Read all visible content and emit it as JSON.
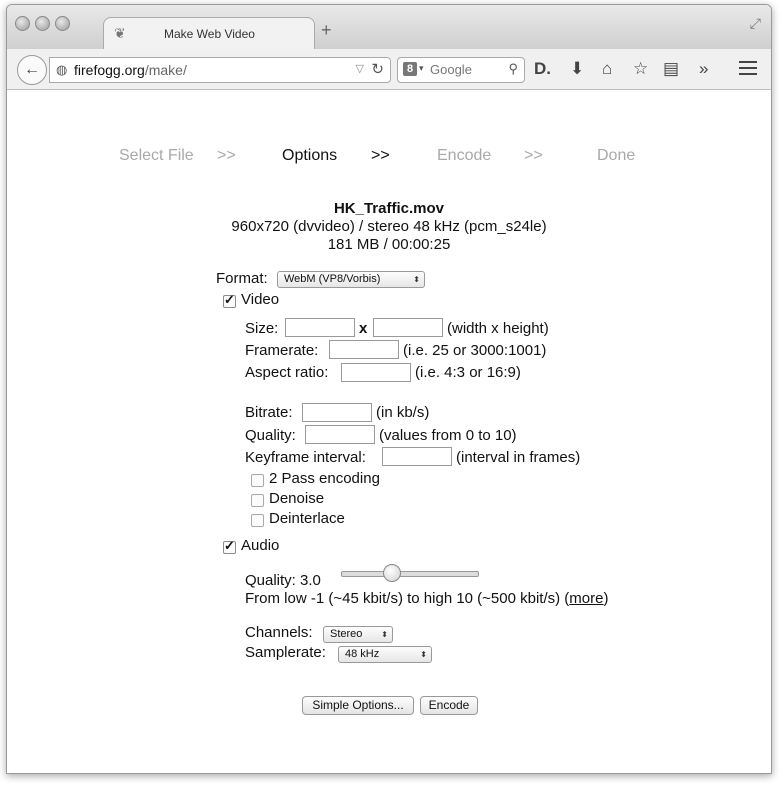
{
  "window": {
    "tab_title": "Make Web Video",
    "url_host": "firefogg.org",
    "url_path": "/make/",
    "search_placeholder": "Google"
  },
  "steps": [
    "Select File",
    ">>",
    "Options",
    ">>",
    "Encode",
    ">>",
    "Done"
  ],
  "file": {
    "name": "HK_Traffic.mov",
    "line1": "960x720 (dvvideo) / stereo 48 kHz (pcm_s24le)",
    "line2": "181 MB / 00:00:25"
  },
  "format": {
    "label": "Format:",
    "value": "WebM (VP8/Vorbis)"
  },
  "video": {
    "label": "Video",
    "checked": true,
    "size_label": "Size:",
    "size_x": "x",
    "size_hint": "(width x height)",
    "framerate_label": "Framerate:",
    "framerate_hint": "(i.e. 25 or 3000:1001)",
    "aspect_label": "Aspect ratio:",
    "aspect_hint": "(i.e. 4:3 or 16:9)",
    "bitrate_label": "Bitrate:",
    "bitrate_hint": "(in kb/s)",
    "quality_label": "Quality:",
    "quality_hint": "(values from 0 to 10)",
    "keyframe_label": "Keyframe interval:",
    "keyframe_hint": "(interval in frames)",
    "two_pass": "2 Pass encoding",
    "denoise": "Denoise",
    "deinterlace": "Deinterlace"
  },
  "audio": {
    "label": "Audio",
    "checked": true,
    "quality_label": "Quality: 3.0",
    "quality_value": 3.0,
    "range_text": "From low -1 (~45 kbit/s) to high 10 (~500 kbit/s) (",
    "more_link": "more",
    "range_close": ")",
    "channels_label": "Channels:",
    "channels_value": "Stereo",
    "samplerate_label": "Samplerate:",
    "samplerate_value": "48 kHz"
  },
  "buttons": {
    "simple": "Simple Options...",
    "encode": "Encode"
  }
}
